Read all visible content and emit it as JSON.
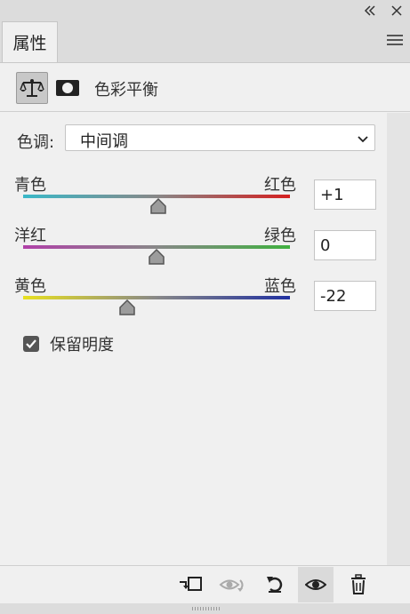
{
  "window": {
    "collapse_icon": "double-chevron-left-icon",
    "close_icon": "close-icon"
  },
  "tab": {
    "label": "属性"
  },
  "header": {
    "title": "色彩平衡",
    "icons": [
      "color-balance-icon",
      "layer-mask-icon"
    ]
  },
  "tone": {
    "label": "色调:",
    "selected": "中间调"
  },
  "sliders": [
    {
      "left_label": "青色",
      "right_label": "红色",
      "value": "+1",
      "amount": 1,
      "colors": [
        "#3ab8c8",
        "#d42020"
      ]
    },
    {
      "left_label": "洋红",
      "right_label": "绿色",
      "value": "0",
      "amount": 0,
      "colors": [
        "#b040a8",
        "#40b040"
      ]
    },
    {
      "left_label": "黄色",
      "right_label": "蓝色",
      "value": "-22",
      "amount": -22,
      "colors": [
        "#e8e020",
        "#2030a0"
      ]
    }
  ],
  "preserve_luminosity": {
    "label": "保留明度",
    "checked": true
  },
  "footer": {
    "buttons": [
      "clip-to-layer-icon",
      "view-previous-state-icon",
      "reset-icon",
      "visibility-eye-icon",
      "trash-icon"
    ]
  }
}
